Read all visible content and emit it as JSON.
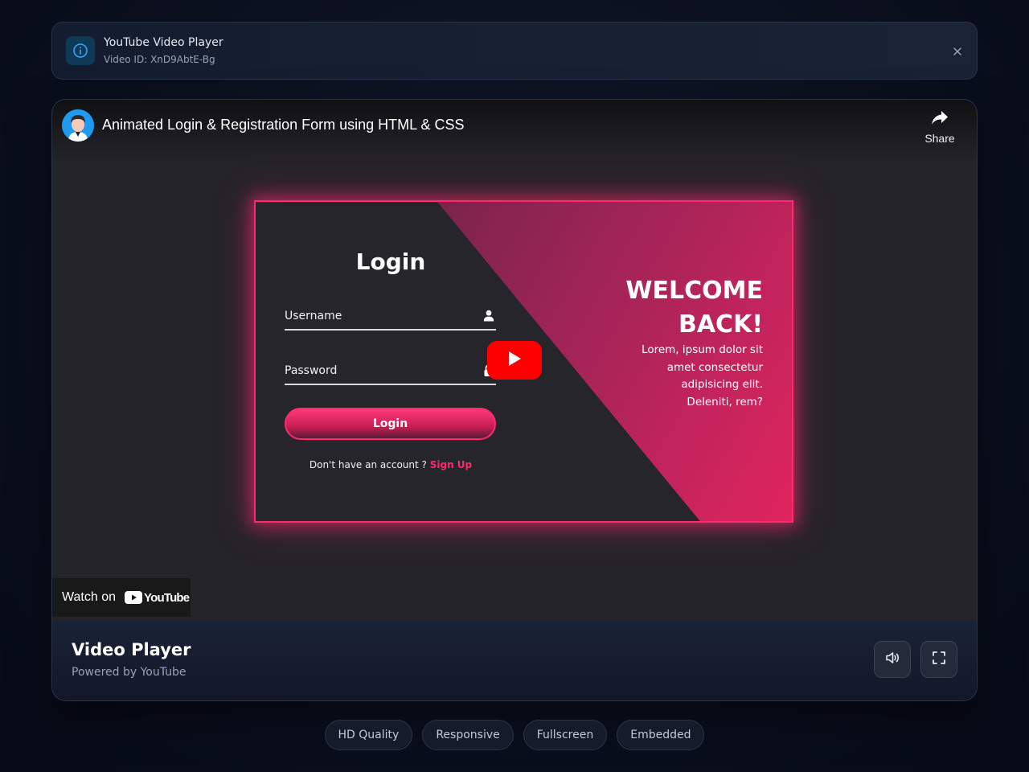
{
  "banner": {
    "icon": "info-icon",
    "title": "YouTube Video Player",
    "subtitle": "Video ID: XnD9AbtE-Bg",
    "close_icon": "close-icon"
  },
  "video": {
    "title": "Animated Login & Registration Form using HTML & CSS",
    "share_label": "Share",
    "watch_on_label": "Watch on",
    "youtube_logo_text": "YouTube",
    "thumbnail": {
      "login_title": "Login",
      "username_label": "Username",
      "password_label": "Password",
      "login_button": "Login",
      "signup_prompt": "Don't have an account ?",
      "signup_link": "Sign Up",
      "welcome_line1": "WELCOME",
      "welcome_line2": "BACK!",
      "lorem_line1": "Lorem, ipsum dolor sit",
      "lorem_line2": "amet consectetur",
      "lorem_line3": "adipisicing elit.",
      "lorem_line4": "Deleniti, rem?"
    }
  },
  "footer": {
    "title": "Video Player",
    "subtitle": "Powered by YouTube",
    "volume_icon": "volume-icon",
    "fullscreen_icon": "fullscreen-icon"
  },
  "tags": [
    "HD Quality",
    "Responsive",
    "Fullscreen",
    "Embedded"
  ],
  "colors": {
    "accent": "#ff2a6d",
    "youtube_red": "#ff0000",
    "page_bg": "#0b1020",
    "card_bg": "#1a2236"
  }
}
